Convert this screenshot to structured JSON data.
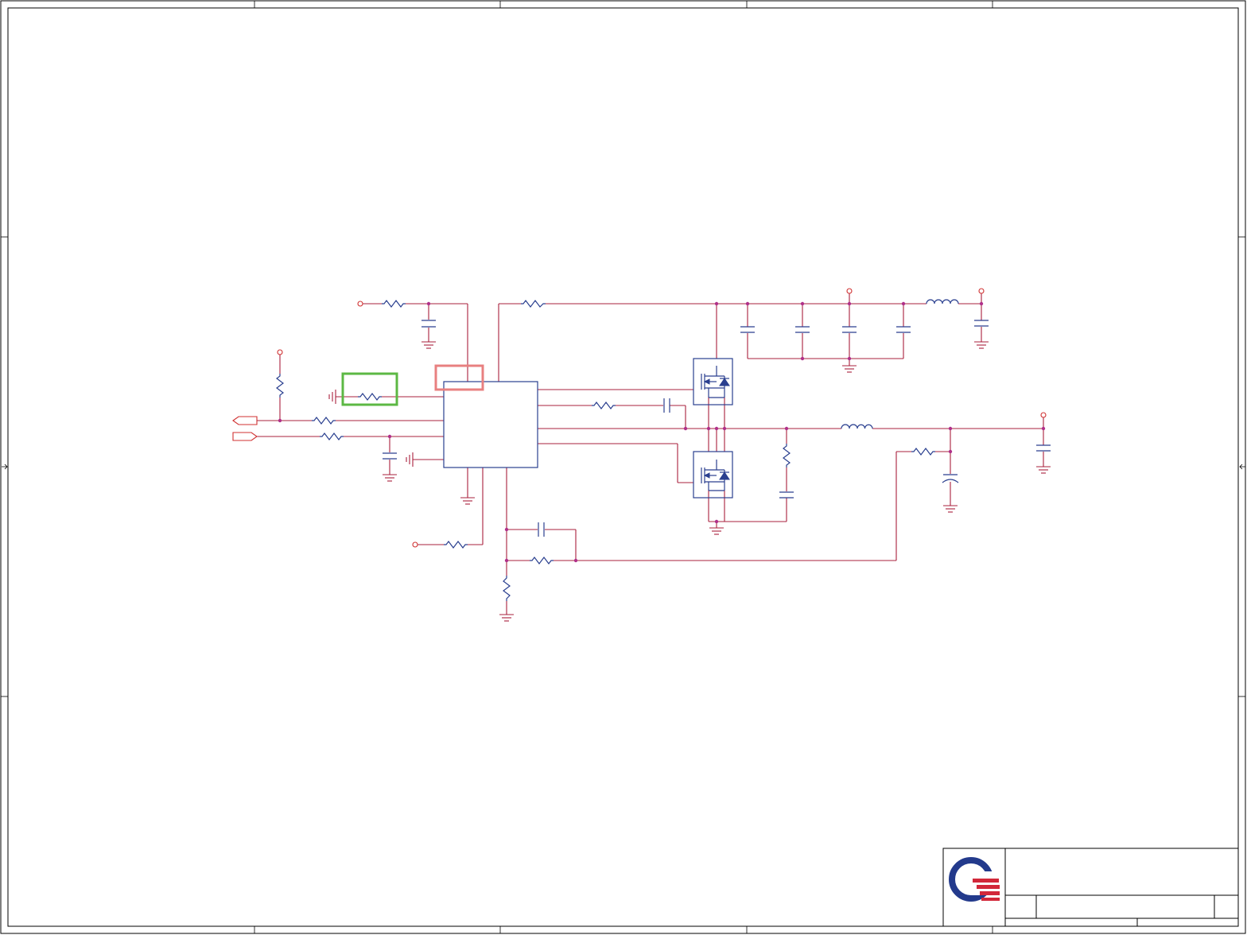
{
  "title_block": {
    "logo_name": "quanta-logo",
    "title": "",
    "size": "",
    "document_number": "",
    "revision": "",
    "date": "",
    "sheet": ""
  },
  "highlights": [
    {
      "name": "green-highlight-box",
      "color": "#5cb844"
    },
    {
      "name": "red-highlight-box",
      "color": "#e88080"
    }
  ],
  "colors": {
    "wire": "#a8203c",
    "component": "#2a3f8f",
    "junction": "#b0308a",
    "port": "#d03030"
  }
}
